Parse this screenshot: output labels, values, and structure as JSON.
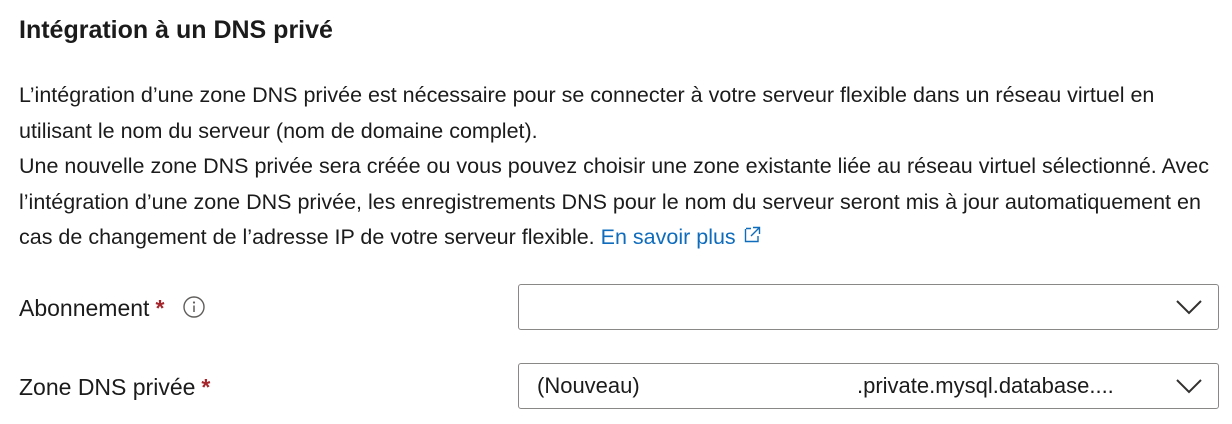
{
  "section": {
    "title": "Intégration à un DNS privé",
    "paragraph1": "L’intégration d’une zone DNS privée est nécessaire pour se connecter à votre serveur flexible dans un réseau virtuel en utilisant le nom du serveur (nom de domaine complet).",
    "paragraph2": "Une nouvelle zone DNS privée sera créée ou vous pouvez choisir une zone existante liée au réseau virtuel sélectionné. Avec l’intégration d’une zone DNS privée, les enregistrements DNS pour le nom du serveur seront mis à jour automatiquement en cas de changement de l’adresse IP de votre serveur flexible.",
    "learn_more": "En savoir plus",
    "learn_more_icon": "external-link-icon"
  },
  "form": {
    "subscription": {
      "label": "Abonnement",
      "required_marker": "*",
      "info_icon": "info-icon",
      "value": ""
    },
    "private_dns_zone": {
      "label": "Zone DNS privée",
      "required_marker": "*",
      "value_prefix": "(Nouveau)",
      "value_suffix": ".private.mysql.database...."
    }
  },
  "colors": {
    "text": "#1b1b1b",
    "link": "#0f6cbd",
    "required": "#a4262c",
    "border": "#8a8886"
  }
}
